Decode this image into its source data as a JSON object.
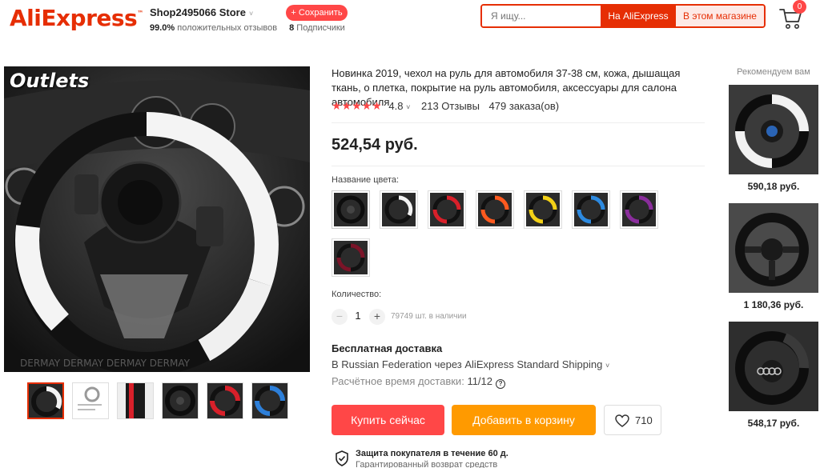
{
  "header": {
    "logo_text": "AliExpress",
    "logo_tm": "™",
    "store_name": "Shop2495066 Store",
    "store_caret": "˅",
    "positive_pct": "99.0%",
    "positive_label": "положительных отзывов",
    "subscribers_count": "8",
    "subscribers_label": "Подписчики",
    "save_label": "+ Сохранить",
    "search_placeholder": "Я ищу...",
    "search_aliexpress": "На AliExpress",
    "search_store": "В этом магазине",
    "cart_count": "0",
    "brand_color": "#e62e04"
  },
  "gallery": {
    "overlay_text": "Outlets",
    "thumb_count": 6,
    "thumb_colors": [
      "#f2f2f2",
      "#d0d0d0",
      "#d8202a",
      "#1a1a1a",
      "#d8202a",
      "#2d7fd9"
    ]
  },
  "product": {
    "title": "Новинка 2019, чехол на руль для автомобиля 37-38 см, кожа, дышащая ткань, о плетка, покрытие на руль автомобиля, аксессуары для салона автомобиля",
    "stars": "★★★★★",
    "rating": "4.8",
    "rating_caret": "˅",
    "reviews": "213 Отзывы",
    "orders": "479 заказа(ов)",
    "price": "524,54 руб.",
    "color_label": "Название цвета:",
    "swatch_colors": [
      "#1a1a1a",
      "#f2f2f2",
      "#d8202a",
      "#ff5a1f",
      "#f3d117",
      "#2d8ae0",
      "#8a2d9c",
      "#7a1428"
    ],
    "quantity_label": "Количество:",
    "quantity_value": "1",
    "minus": "−",
    "plus": "+",
    "stock": "79749 шт. в наличии"
  },
  "shipping": {
    "title": "Бесплатная доставка",
    "route": "В Russian Federation через AliExpress Standard Shipping",
    "route_caret": "˅",
    "time_label": "Расчётное время доставки:",
    "time_value": "11/12",
    "help": "?"
  },
  "actions": {
    "buy_now": "Купить сейчас",
    "add_to_cart": "Добавить в корзину",
    "wishlist_count": "710",
    "buy_color": "#ff4747",
    "cart_color": "#ff9a00"
  },
  "protection": {
    "title": "Защита покупателя в течение 60 д.",
    "subtitle": "Гарантированный возврат средств"
  },
  "recommended": {
    "label": "Рекомендуем вам",
    "items": [
      {
        "price": "590,18 руб."
      },
      {
        "price": "1 180,36 руб."
      },
      {
        "price": "548,17 руб."
      }
    ]
  }
}
